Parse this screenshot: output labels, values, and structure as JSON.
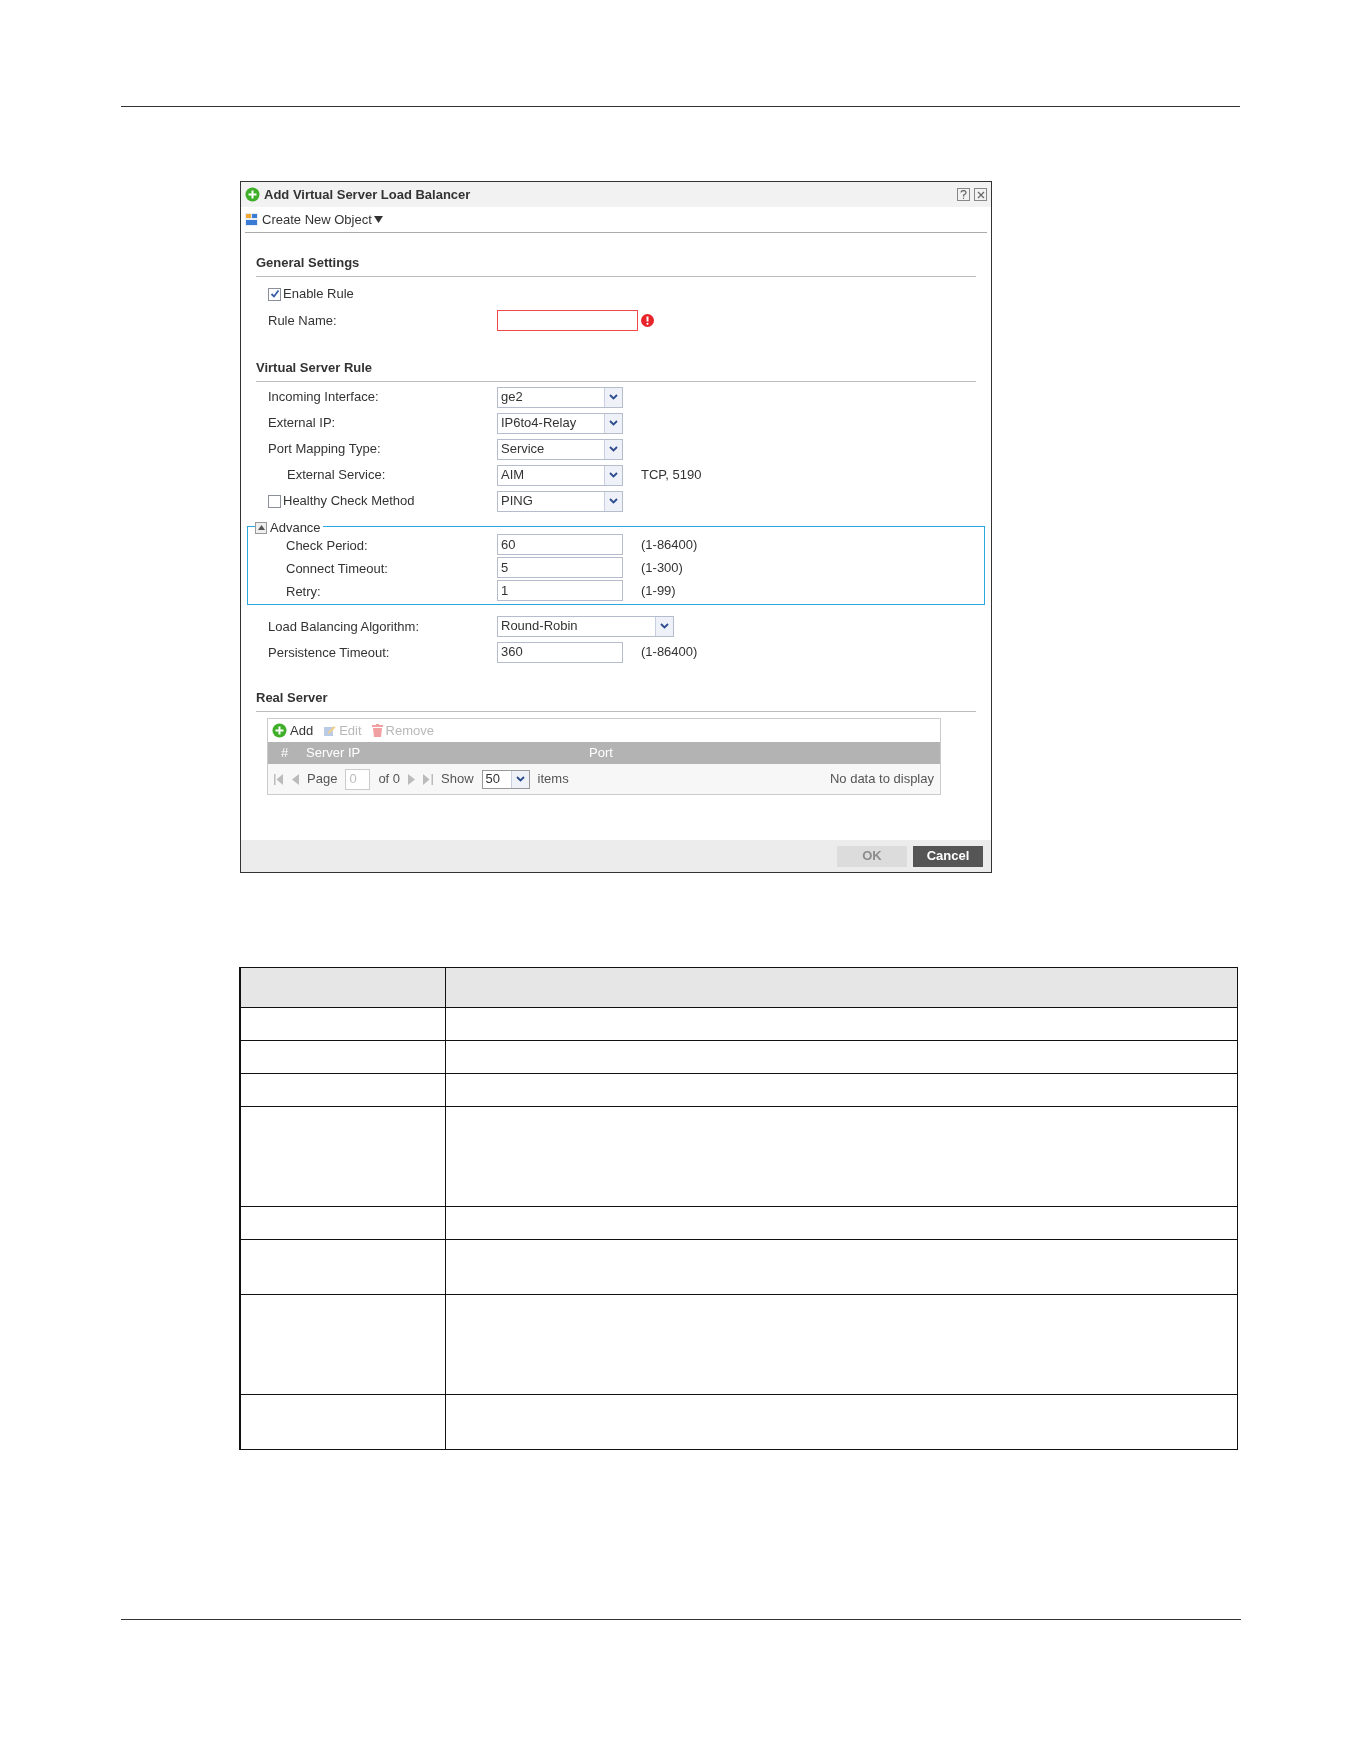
{
  "dialog": {
    "title": "Add Virtual Server Load Balancer",
    "toolbar": {
      "label": "Create New Object"
    },
    "general_settings": {
      "title": "General Settings",
      "enable_rule": {
        "label": "Enable Rule",
        "checked": true
      },
      "rule_name": {
        "label": "Rule Name:",
        "invalid": true
      }
    },
    "virtual_server_rule": {
      "title": "Virtual Server Rule",
      "fields": [
        {
          "kind": "select",
          "label": "Incoming Interface:",
          "value": "ge2"
        },
        {
          "kind": "select",
          "label": "External IP:",
          "value": "IP6to4-Relay"
        },
        {
          "kind": "select",
          "label": "Port Mapping Type:",
          "value": "Service"
        },
        {
          "kind": "sub_select",
          "label": "External Service:",
          "value": "AIM",
          "note": "TCP, 5190"
        },
        {
          "kind": "checkbox_select",
          "label": "Healthy Check Method",
          "value": "PING",
          "checked": false
        }
      ]
    },
    "advance": {
      "label": "Advance",
      "expanded": true,
      "fields": [
        {
          "label": "Check Period:",
          "value": "60",
          "hint": "(1-86400)"
        },
        {
          "label": "Connect Timeout:",
          "value": "5",
          "hint": "(1-300)"
        },
        {
          "label": "Retry:",
          "value": "1",
          "hint": "(1-99)"
        }
      ]
    },
    "balancing": [
      {
        "kind": "wide_select",
        "label": "Load Balancing Algorithm:",
        "value": "Round-Robin"
      },
      {
        "kind": "input",
        "label": "Persistence Timeout:",
        "value": "360",
        "hint": "(1-86400)"
      }
    ],
    "real_server": {
      "title": "Real Server",
      "actions": [
        {
          "kind": "add",
          "label": "Add",
          "disabled": false
        },
        {
          "kind": "edit",
          "label": "Edit",
          "disabled": true
        },
        {
          "kind": "remove",
          "label": "Remove",
          "disabled": true
        }
      ],
      "columns": [
        "#",
        "Server IP",
        "Port"
      ],
      "pager": {
        "page_label": "Page",
        "page_value": "0",
        "of": "of 0",
        "show": "Show",
        "per_page": "50",
        "items": "items",
        "empty": "No data to display"
      }
    },
    "buttons": [
      {
        "label": "OK",
        "disabled": true
      },
      {
        "label": "Cancel",
        "disabled": false
      }
    ]
  },
  "description_table": {
    "rows": [
      {
        "kind": "header"
      },
      {
        "kind": "short"
      },
      {
        "kind": "short"
      },
      {
        "kind": "short"
      },
      {
        "kind": "tall"
      },
      {
        "kind": "short"
      },
      {
        "kind": "medium"
      },
      {
        "kind": "tall"
      },
      {
        "kind": "medium"
      }
    ]
  }
}
